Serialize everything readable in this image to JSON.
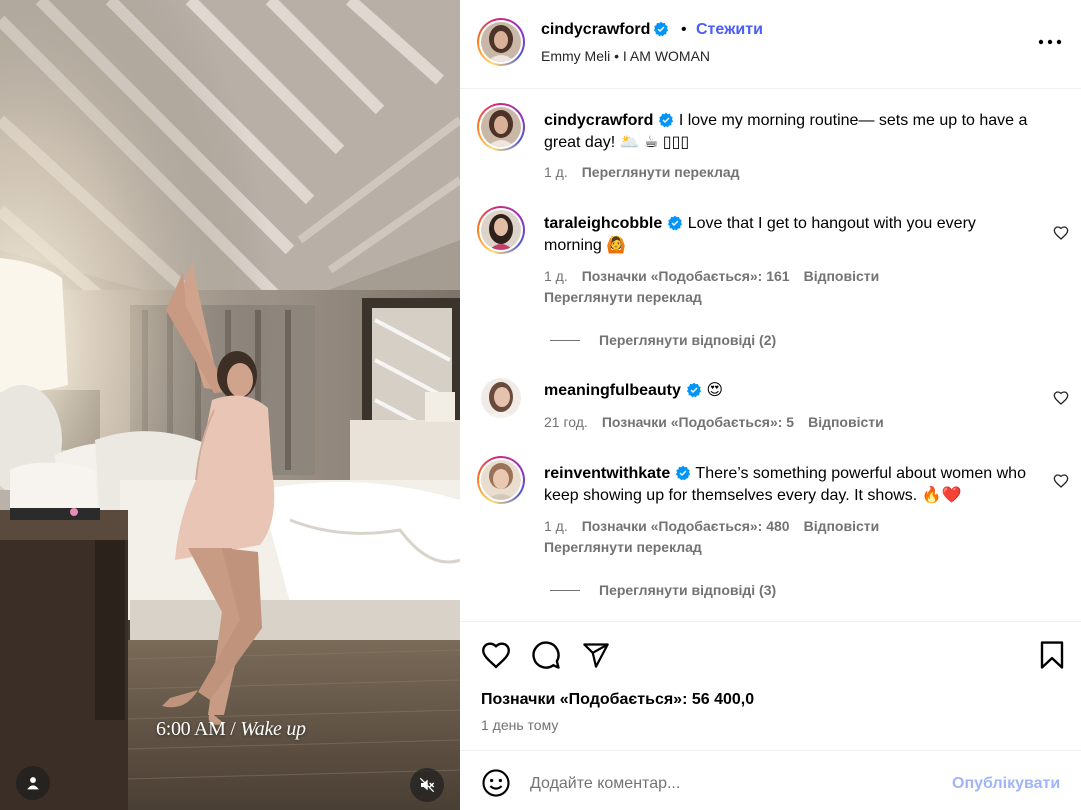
{
  "media": {
    "overlay_time": "6:00 AM /",
    "overlay_label": "Wake up"
  },
  "header": {
    "username": "cindycrawford",
    "dot": "•",
    "follow_label": "Стежити",
    "audio_artist": "Emmy Meli",
    "audio_dot": "•",
    "audio_track": "I AM WOMAN"
  },
  "caption": {
    "username": "cindycrawford",
    "text": "I love my morning routine— sets me up to have a great day! 🌥️ ☕ ▯▯▯",
    "time": "1 д.",
    "translate": "Переглянути переклад"
  },
  "comments": [
    {
      "username": "taraleighcobble",
      "text": "Love that I get to hangout with you every morning 🙆",
      "time": "1 д.",
      "likes": "Позначки «Подобається»: 161",
      "reply": "Відповісти",
      "translate": "Переглянути переклад",
      "replies": "Переглянути відповіді (2)"
    },
    {
      "username": "meaningfulbeauty",
      "text": "😍",
      "time": "21 год.",
      "likes": "Позначки «Подобається»: 5",
      "reply": "Відповісти"
    },
    {
      "username": "reinventwithkate",
      "text": "There’s something powerful about women who keep showing up for themselves every day. It shows. 🔥❤️",
      "time": "1 д.",
      "likes": "Позначки «Подобається»: 480",
      "reply": "Відповісти",
      "translate": "Переглянути переклад",
      "replies": "Переглянути відповіді (3)"
    }
  ],
  "post": {
    "likes": "Позначки «Подобається»: 56 400,0",
    "time": "1 день тому"
  },
  "add_comment": {
    "placeholder": "Додайте коментар...",
    "publish": "Опублікувати"
  },
  "colors": {
    "link_blue": "#4a5df9",
    "publish_disabled": "#9fb5f7",
    "verified": "#0095f6",
    "muted_text": "#737373"
  },
  "icons": [
    "verified-badge-icon",
    "more-options-icon",
    "heart-icon",
    "comment-icon",
    "share-icon",
    "bookmark-icon",
    "emoji-icon",
    "user-tag-icon",
    "mute-icon"
  ]
}
